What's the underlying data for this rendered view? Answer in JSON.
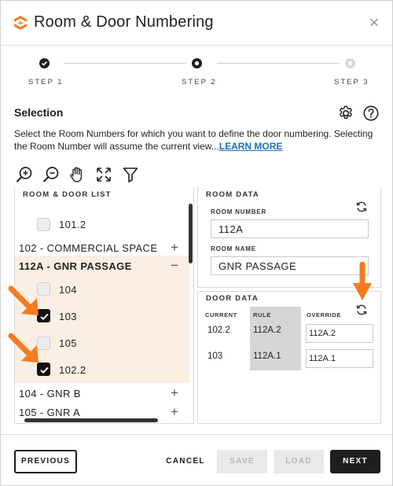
{
  "dialog": {
    "title": "Room & Door Numbering",
    "close_label": "×"
  },
  "steps": [
    {
      "label": "STEP 1",
      "state": "complete"
    },
    {
      "label": "STEP 2",
      "state": "current"
    },
    {
      "label": "STEP 3",
      "state": "pending"
    }
  ],
  "selection": {
    "title": "Selection",
    "description": "Select the Room Numbers for which you want to define the door numbering. Selecting the Room Number will assume the current view...",
    "learn_more": "LEARN MORE"
  },
  "toolbar": {
    "icons": [
      "zoom-in-icon",
      "zoom-out-icon",
      "pan-hand-icon",
      "fit-view-icon",
      "filter-icon"
    ]
  },
  "room_door_list": {
    "header": "ROOM & DOOR LIST",
    "rows": [
      {
        "kind": "door",
        "label": "101.2",
        "checked": false
      },
      {
        "kind": "room",
        "label": "102 - COMMERCIAL SPACE",
        "expanded": false,
        "toggle": "+"
      },
      {
        "kind": "room",
        "label": "112A - GNR PASSAGE",
        "expanded": true,
        "toggle": "−"
      },
      {
        "kind": "door",
        "label": "104",
        "checked": false
      },
      {
        "kind": "door",
        "label": "103",
        "checked": true
      },
      {
        "kind": "door",
        "label": "105",
        "checked": false
      },
      {
        "kind": "door",
        "label": "102.2",
        "checked": true
      },
      {
        "kind": "room",
        "label": "104 - GNR B",
        "expanded": false,
        "toggle": "+"
      },
      {
        "kind": "room",
        "label": "105 - GNR A",
        "expanded": false,
        "toggle": "+"
      }
    ]
  },
  "room_data": {
    "title": "ROOM DATA",
    "room_number_label": "ROOM NUMBER",
    "room_number": "112A",
    "room_name_label": "ROOM NAME",
    "room_name": "GNR PASSAGE"
  },
  "door_data": {
    "title": "DOOR DATA",
    "columns": [
      "CURRENT",
      "RULE",
      "OVERRIDE"
    ],
    "rows": [
      {
        "current": "102.2",
        "rule": "112A.2",
        "override": "112A.2"
      },
      {
        "current": "103",
        "rule": "112A.1",
        "override": "112A.1"
      }
    ]
  },
  "footer": {
    "previous": "PREVIOUS",
    "cancel": "CANCEL",
    "save": "SAVE",
    "load": "LOAD",
    "next": "NEXT"
  },
  "colors": {
    "accent_orange": "#f47b20",
    "highlight_bg": "#fbeee3",
    "primary_dark": "#1e1e1e",
    "link_blue": "#1a6fc2",
    "disabled_bg": "#e9e9e9"
  }
}
